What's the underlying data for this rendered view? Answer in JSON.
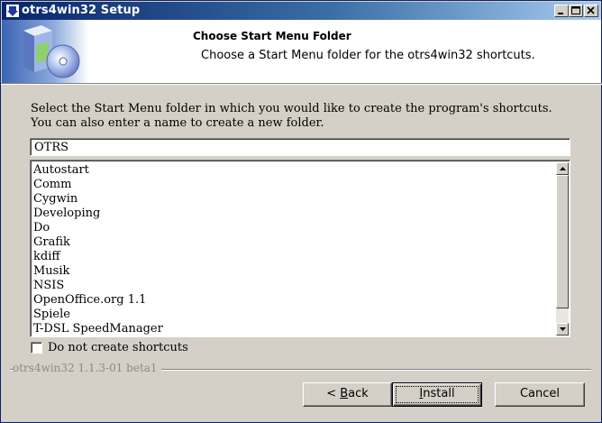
{
  "window": {
    "title": "otrs4win32 Setup"
  },
  "header": {
    "title": "Choose Start Menu Folder",
    "subtitle": "Choose a Start Menu folder for the otrs4win32 shortcuts."
  },
  "instructions": "Select the Start Menu folder in which you would like to create the program's shortcuts. You can also enter a name to create a new folder.",
  "folder_input": {
    "value": "OTRS"
  },
  "folder_list": {
    "items": [
      "Autostart",
      "Comm",
      "Cygwin",
      "Developing",
      "Do",
      "Grafik",
      "kdiff",
      "Musik",
      "NSIS",
      "OpenOffice.org 1.1",
      "Spiele",
      "T-DSL SpeedManager"
    ]
  },
  "checkbox": {
    "label": "Do not create shortcuts",
    "checked": false
  },
  "branding": "otrs4win32 1.1.3-01 beta1",
  "buttons": {
    "back": "< Back",
    "install": "Install",
    "cancel": "Cancel"
  },
  "colors": {
    "titlebar_start": "#0a246a",
    "titlebar_end": "#a6caf0",
    "face": "#d4d0c8"
  }
}
